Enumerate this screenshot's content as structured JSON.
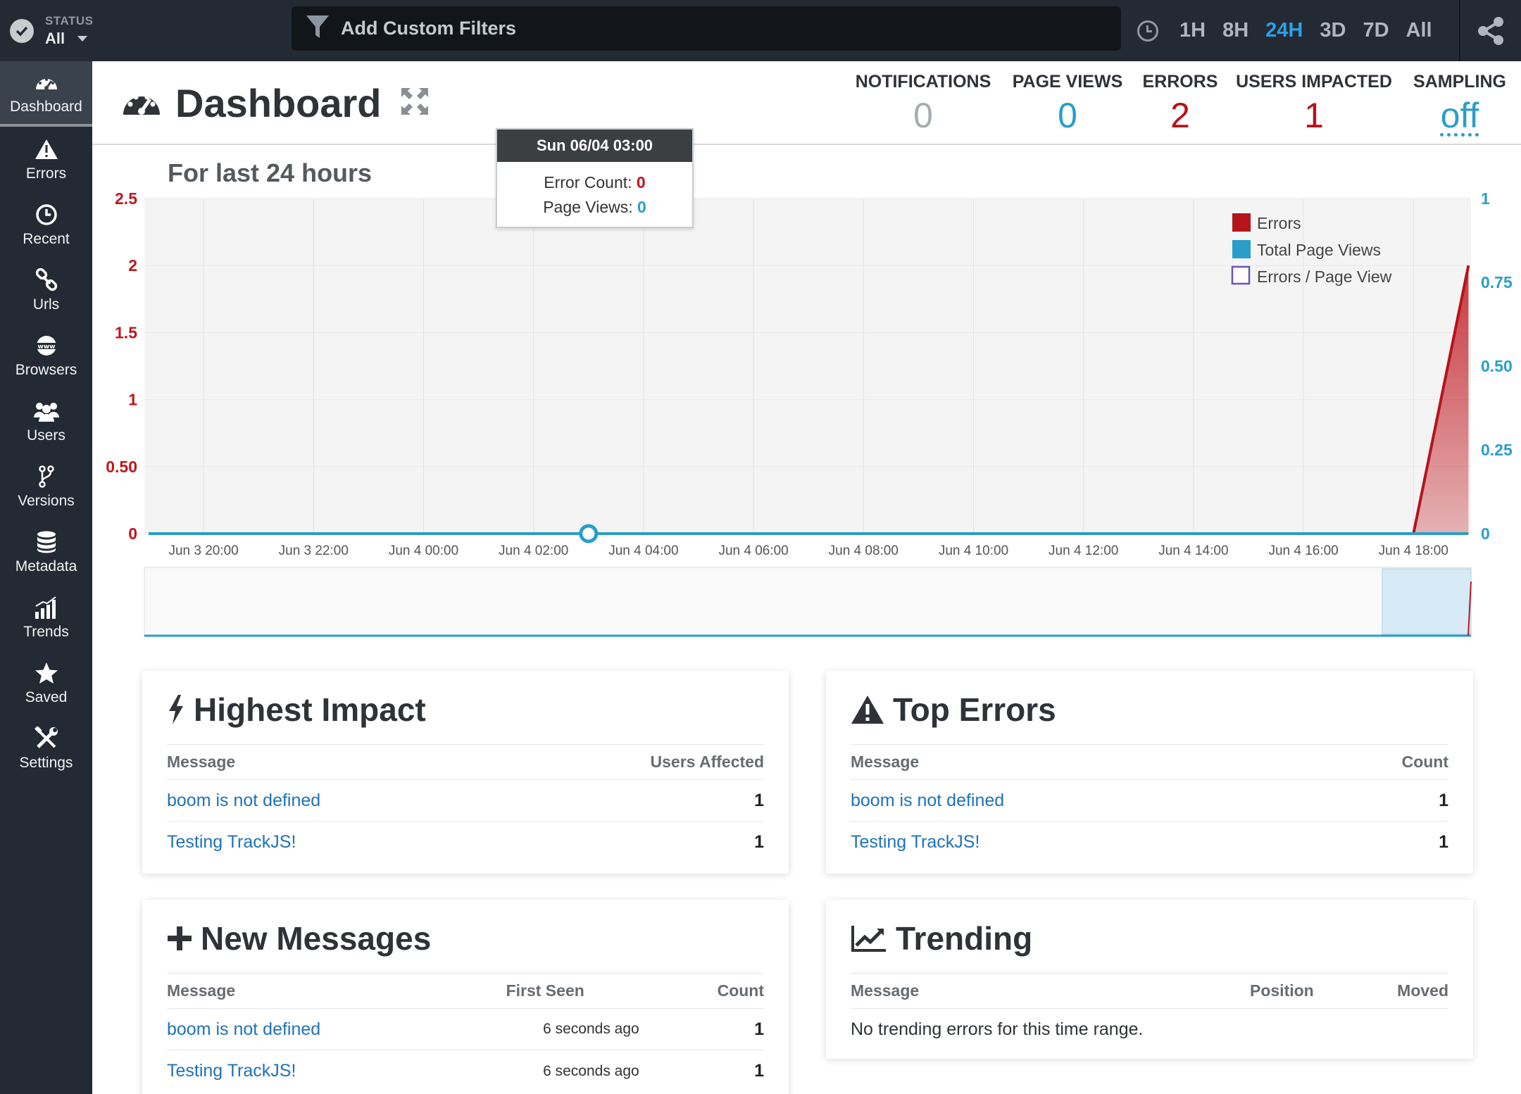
{
  "topbar": {
    "status_label": "STATUS",
    "status_value": "All",
    "filter_placeholder": "Add Custom Filters",
    "ranges": [
      "1H",
      "8H",
      "24H",
      "3D",
      "7D",
      "All"
    ],
    "active_range": "24H"
  },
  "sidebar": {
    "items": [
      {
        "label": "Dashboard",
        "icon": "gauge-icon",
        "active": true
      },
      {
        "label": "Errors",
        "icon": "warning-icon"
      },
      {
        "label": "Recent",
        "icon": "clock-icon"
      },
      {
        "label": "Urls",
        "icon": "link-icon"
      },
      {
        "label": "Browsers",
        "icon": "www-globe-icon"
      },
      {
        "label": "Users",
        "icon": "users-icon"
      },
      {
        "label": "Versions",
        "icon": "branch-icon"
      },
      {
        "label": "Metadata",
        "icon": "database-icon"
      },
      {
        "label": "Trends",
        "icon": "bar-chart-icon"
      },
      {
        "label": "Saved",
        "icon": "star-icon"
      },
      {
        "label": "Settings",
        "icon": "tools-icon"
      }
    ]
  },
  "header": {
    "title": "Dashboard",
    "stats": [
      {
        "label": "NOTIFICATIONS",
        "value": "0",
        "color": "#a7acb1"
      },
      {
        "label": "PAGE VIEWS",
        "value": "0",
        "color": "#2a9ec9"
      },
      {
        "label": "ERRORS",
        "value": "2",
        "color": "#b5141a"
      },
      {
        "label": "USERS IMPACTED",
        "value": "1",
        "color": "#b5141a"
      },
      {
        "label": "SAMPLING",
        "value": "off",
        "color": "#2a9ec9"
      }
    ]
  },
  "chart_title": "For last 24 hours",
  "tooltip": {
    "title": "Sun 06/04 03:00",
    "error_label": "Error Count:",
    "error_value": "0",
    "pv_label": "Page Views:",
    "pv_value": "0"
  },
  "chart_data": {
    "type": "area",
    "x_ticks": [
      "Jun 3 20:00",
      "Jun 3 22:00",
      "Jun 4 00:00",
      "Jun 4 02:00",
      "Jun 4 04:00",
      "Jun 4 06:00",
      "Jun 4 08:00",
      "Jun 4 10:00",
      "Jun 4 12:00",
      "Jun 4 14:00",
      "Jun 4 16:00",
      "Jun 4 18:00"
    ],
    "y_left": {
      "ticks": [
        "0",
        "0.50",
        "1",
        "1.5",
        "2",
        "2.5"
      ],
      "range": [
        0,
        2.5
      ],
      "color": "#c0161d"
    },
    "y_right": {
      "ticks": [
        "0",
        "0.25",
        "0.50",
        "0.75",
        "1"
      ],
      "range": [
        0,
        1
      ],
      "color": "#2a9ec9"
    },
    "series": [
      {
        "name": "Errors",
        "color": "#b5141a",
        "points": [
          [
            "Jun 4 18:00",
            0
          ],
          [
            "Jun 4 19:00",
            2
          ]
        ]
      },
      {
        "name": "Total Page Views",
        "color": "#2a9ec9",
        "points": [
          [
            "Jun 3 19:00",
            0
          ],
          [
            "Jun 4 19:00",
            0
          ]
        ]
      },
      {
        "name": "Errors / Page View",
        "color": "#6b55b8",
        "points": []
      }
    ],
    "hover_point": "Jun 4 03:00",
    "legend": "top-right"
  },
  "cards": {
    "highest_impact": {
      "title": "Highest Impact",
      "columns": [
        "Message",
        "Users Affected"
      ],
      "rows": [
        {
          "message": "boom is not defined",
          "value": "1"
        },
        {
          "message": "Testing TrackJS!",
          "value": "1"
        }
      ]
    },
    "top_errors": {
      "title": "Top Errors",
      "columns": [
        "Message",
        "Count"
      ],
      "rows": [
        {
          "message": "boom is not defined",
          "value": "1"
        },
        {
          "message": "Testing TrackJS!",
          "value": "1"
        }
      ]
    },
    "new_messages": {
      "title": "New Messages",
      "columns": [
        "Message",
        "First Seen",
        "Count"
      ],
      "rows": [
        {
          "message": "boom is not defined",
          "first_seen": "6 seconds ago",
          "value": "1"
        },
        {
          "message": "Testing TrackJS!",
          "first_seen": "6 seconds ago",
          "value": "1"
        }
      ]
    },
    "trending": {
      "title": "Trending",
      "columns": [
        "Message",
        "Position",
        "Moved"
      ],
      "empty_text": "No trending errors for this time range."
    }
  }
}
